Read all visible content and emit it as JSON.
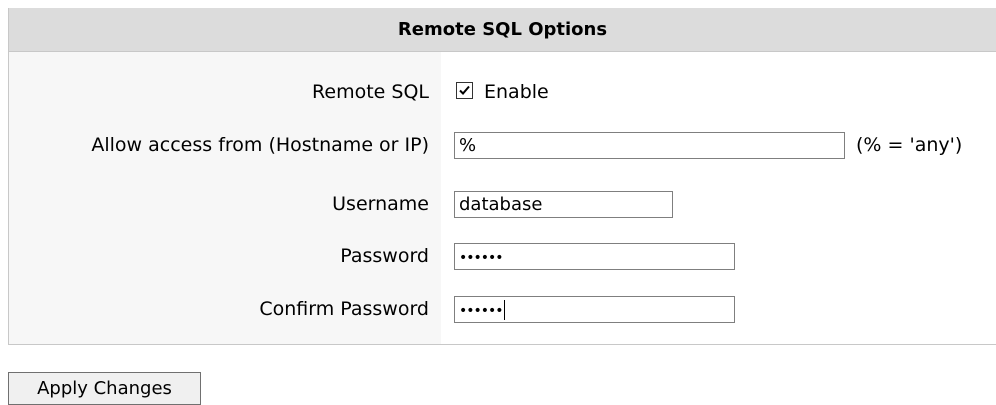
{
  "panel": {
    "title": "Remote SQL Options"
  },
  "fields": {
    "remote_sql": {
      "label": "Remote SQL",
      "checkbox_label": "Enable",
      "checked": true
    },
    "allow_access": {
      "label": "Allow access from (Hostname or IP)",
      "value": "%",
      "hint": "(% = 'any')"
    },
    "username": {
      "label": "Username",
      "value": "database"
    },
    "password": {
      "label": "Password",
      "masked_value": "••••••"
    },
    "confirm_password": {
      "label": "Confirm Password",
      "masked_value": "••••••"
    }
  },
  "actions": {
    "apply_label": "Apply Changes"
  }
}
